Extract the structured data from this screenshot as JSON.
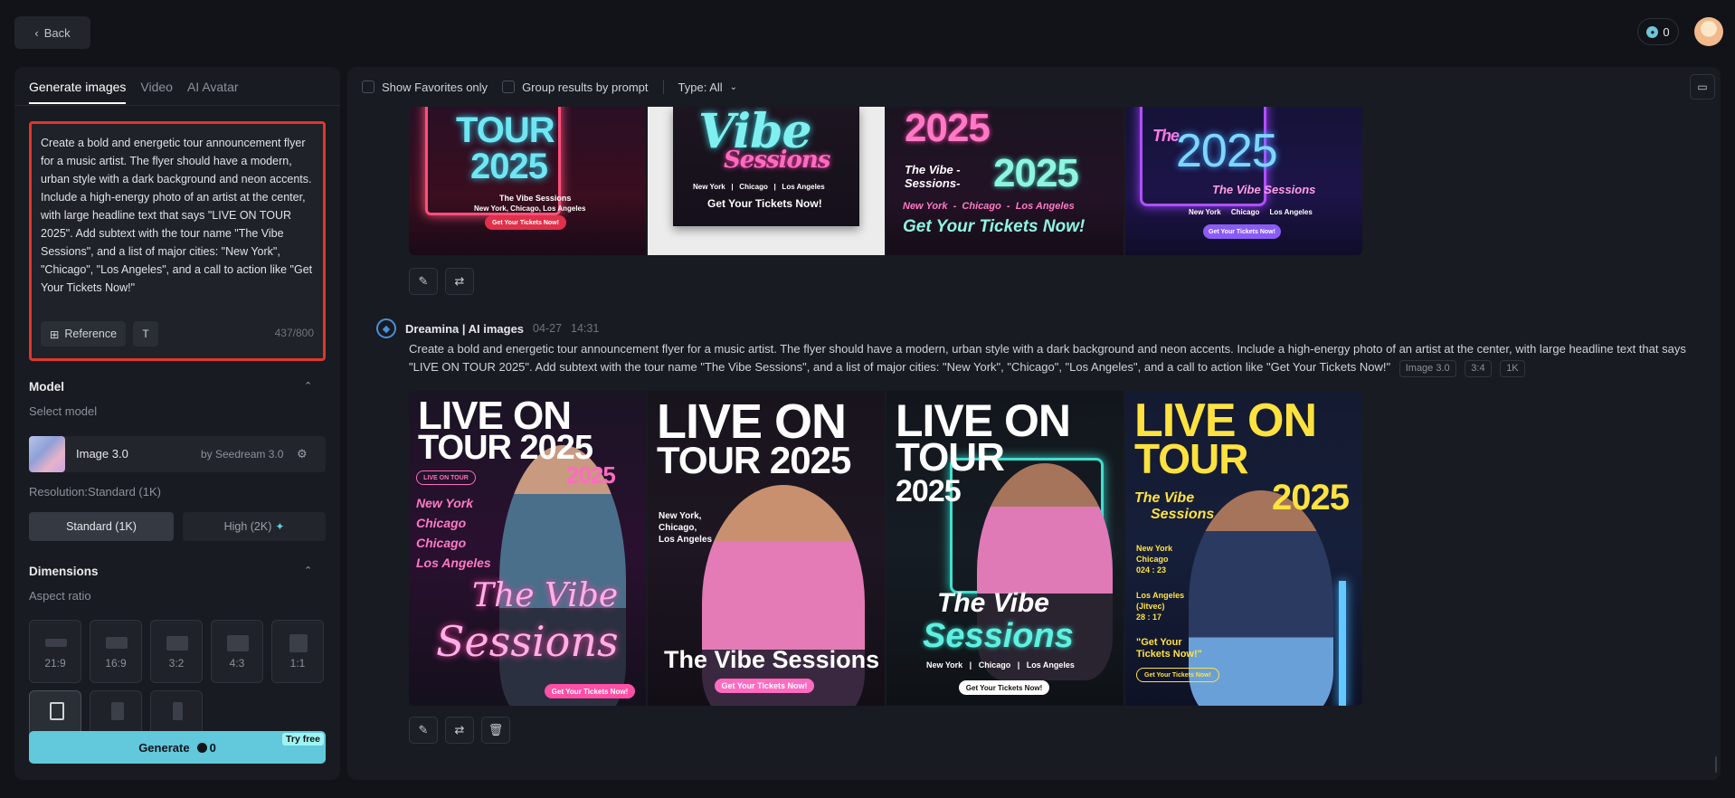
{
  "topbar": {
    "back_label": "Back",
    "credits": "0"
  },
  "left": {
    "tabs": [
      {
        "label": "Generate images"
      },
      {
        "label": "Video"
      },
      {
        "label": "AI Avatar"
      }
    ],
    "prompt": "Create a bold and energetic tour announcement flyer for a music artist. The flyer should have a modern, urban style with a dark background and neon accents. Include a high-energy photo of an artist at the center, with large headline text that says \"LIVE ON TOUR 2025\". Add subtext with the tour name \"The Vibe Sessions\", and a list of major cities: \"New York\", \"Chicago\", \"Los Angeles\", and a call to action like \"Get Your Tickets Now!\"",
    "reference_label": "Reference",
    "text_icon_label": "T",
    "char_count": "437/800",
    "model_section": "Model",
    "select_model_label": "Select model",
    "model_name": "Image 3.0",
    "model_by": "by Seedream 3.0",
    "resolution_label": "Resolution:Standard (1K)",
    "res_standard": "Standard (1K)",
    "res_high": "High (2K)",
    "dimensions_section": "Dimensions",
    "aspect_ratio_label": "Aspect ratio",
    "aspect_ratios": [
      "21:9",
      "16:9",
      "3:2",
      "4:3",
      "1:1"
    ],
    "generate_label": "Generate",
    "generate_credits": "0",
    "try_free": "Try free"
  },
  "main": {
    "show_favorites": "Show Favorites only",
    "group_results": "Group results by prompt",
    "type_filter": "Type: All",
    "generation": {
      "author": "Dreamina | AI images",
      "date": "04-27",
      "time": "14:31",
      "prompt": "Create a bold and energetic tour announcement flyer for a music artist. The flyer should have a modern, urban style with a dark background and neon accents. Include a high-energy photo of an artist at the center, with large headline text that says \"LIVE ON TOUR 2025\". Add subtext with the tour name \"The Vibe Sessions\", and a list of major cities: \"New York\", \"Chicago\", \"Los Angeles\", and a call to action like \"Get Your Tickets Now!\"",
      "tags": [
        "Image 3.0",
        "3:4",
        "1K"
      ]
    },
    "top_images": [
      {
        "line1": "TOUR",
        "line2": "2025",
        "sub": "The Vibe Sessions",
        "cities": "New York, Chicago, Los Angeles",
        "cta": "Get Your Tickets Now!"
      },
      {
        "line1": "Vibe",
        "line2": "Sessions",
        "cities": "New York   |   Chicago   |   Los Angeles",
        "cta": "Get Your Tickets Now!"
      },
      {
        "line1": "2025",
        "line2": "2025",
        "sub": "The Vibe -Sessions-",
        "cities": "New York  -  Chicago  -  Los Angeles",
        "cta": "Get Your Tickets Now!"
      },
      {
        "line1": "The",
        "line2": "2025",
        "sub": "The Vibe Sessions",
        "cities": "New York     Chicago     Los Angeles",
        "cta": "Get Your Tickets Now!"
      }
    ],
    "main_images": [
      {
        "line1": "LIVE ON",
        "line2": "TOUR 2025",
        "line3": "2025",
        "badge": "LIVE ON TOUR",
        "cities": [
          "New York",
          "Chicago",
          "Chicago",
          "Los Angeles"
        ],
        "sub1": "The Vibe",
        "sub2": "Sessions",
        "cta": "Get Your Tickets Now!"
      },
      {
        "line1": "LIVE ON",
        "line2": "TOUR 2025",
        "cities_text": "New York,\nChicago,\nLos Angeles",
        "sub": "The Vibe Sessions",
        "cta": "Get Your Tickets Now!"
      },
      {
        "line1": "LIVE ON",
        "line2": "TOUR",
        "line3": "2025",
        "sub1": "The Vibe",
        "sub2": "Sessions",
        "cities": "New York   |   Chicago   |   Los Angeles",
        "cta": "Get Your Tickets Now!"
      },
      {
        "line1": "LIVE ON",
        "line2": "TOUR",
        "line3": "2025",
        "sub1": "The Vibe",
        "sub2": "Sessions",
        "cities_text": "New York\nChicago\n024 : 23",
        "la_text": "Los Angeles\n(Jitvec)\n28 : 17",
        "cta1": "\"Get Your",
        "cta2": "Tickets Now!\"",
        "cta_btn": "Get Your Tickets Now!"
      }
    ]
  }
}
